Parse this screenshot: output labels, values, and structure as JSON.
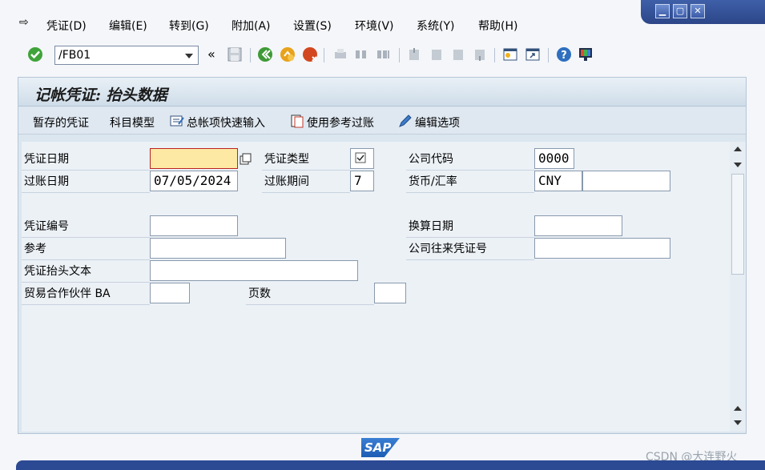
{
  "menu": [
    {
      "label": "凭证(D)"
    },
    {
      "label": "编辑(E)"
    },
    {
      "label": "转到(G)"
    },
    {
      "label": "附加(A)"
    },
    {
      "label": "设置(S)"
    },
    {
      "label": "环境(V)"
    },
    {
      "label": "系统(Y)"
    },
    {
      "label": "帮助(H)"
    }
  ],
  "toolbar": {
    "command": "/FB01"
  },
  "screen": {
    "title": "记帐凭证: 抬头数据"
  },
  "appbar": {
    "park": "暂存的凭证",
    "account_model": "科目模型",
    "gl_fast_entry": "总帐项快速输入",
    "post_with_ref": "使用参考过账",
    "edit_options": "编辑选项"
  },
  "form": {
    "doc_date_label": "凭证日期",
    "doc_date_value": "",
    "doc_type_label": "凭证类型",
    "doc_type_value": "",
    "company_code_label": "公司代码",
    "company_code_value": "0000",
    "posting_date_label": "过账日期",
    "posting_date_value": "07/05/2024",
    "period_label": "过账期间",
    "period_value": "7",
    "currency_label": "货币/汇率",
    "currency_value": "CNY",
    "rate_value": "",
    "doc_number_label": "凭证编号",
    "doc_number_value": "",
    "translation_date_label": "换算日期",
    "translation_date_value": "",
    "reference_label": "参考",
    "reference_value": "",
    "intercompany_label": "公司往来凭证号",
    "intercompany_value": "",
    "header_text_label": "凭证抬头文本",
    "header_text_value": "",
    "trading_partner_label": "贸易合作伙伴 BA",
    "trading_partner_value": "",
    "pages_label": "页数",
    "pages_value": ""
  },
  "branding": {
    "logo": "SAP"
  },
  "watermark": "CSDN @大连野火"
}
